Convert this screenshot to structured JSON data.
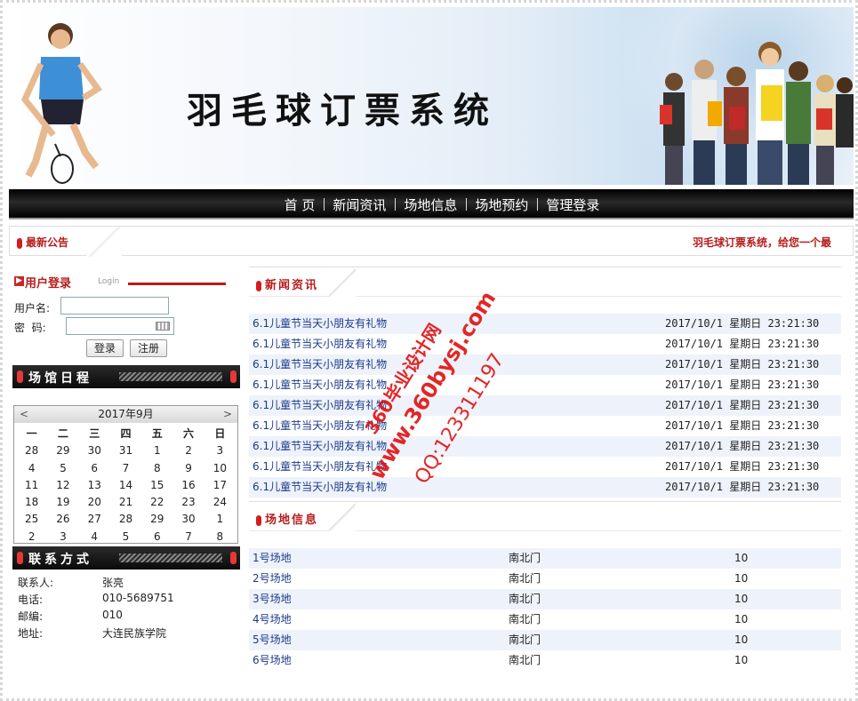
{
  "header": {
    "title": "羽毛球订票系统"
  },
  "nav": [
    "首 页",
    "新闻资讯",
    "场地信息",
    "场地预约",
    "管理登录"
  ],
  "notice": {
    "label": "最新公告",
    "marquee": "羽毛球订票系统，给您一个最"
  },
  "login": {
    "title": "用户登录",
    "title_en": "Login",
    "username_label": "用户名:",
    "password_label": "密  码:",
    "login_button": "登录",
    "register_button": "注册"
  },
  "schedule": {
    "title": "场馆日程",
    "month_label": "2017年9月",
    "prev": "<",
    "next": ">",
    "weekdays": [
      "一",
      "二",
      "三",
      "四",
      "五",
      "六",
      "日"
    ],
    "days": [
      "28",
      "29",
      "30",
      "31",
      "1",
      "2",
      "3",
      "4",
      "5",
      "6",
      "7",
      "8",
      "9",
      "10",
      "11",
      "12",
      "13",
      "14",
      "15",
      "16",
      "17",
      "18",
      "19",
      "20",
      "21",
      "22",
      "23",
      "24",
      "25",
      "26",
      "27",
      "28",
      "29",
      "30",
      "1",
      "2",
      "3",
      "4",
      "5",
      "6",
      "7",
      "8"
    ]
  },
  "contact": {
    "title": "联系方式",
    "items": [
      {
        "k": "联系人:",
        "v": "张亮"
      },
      {
        "k": "电话:",
        "v": "010-5689751"
      },
      {
        "k": "邮编:",
        "v": "010"
      },
      {
        "k": "地址:",
        "v": "大连民族学院"
      }
    ]
  },
  "news": {
    "title": "新闻资讯",
    "items": [
      {
        "title": "6.1儿童节当天小朋友有礼物",
        "date": "2017/10/1 星期日 23:21:30"
      },
      {
        "title": "6.1儿童节当天小朋友有礼物",
        "date": "2017/10/1 星期日 23:21:30"
      },
      {
        "title": "6.1儿童节当天小朋友有礼物",
        "date": "2017/10/1 星期日 23:21:30"
      },
      {
        "title": "6.1儿童节当天小朋友有礼物",
        "date": "2017/10/1 星期日 23:21:30"
      },
      {
        "title": "6.1儿童节当天小朋友有礼物",
        "date": "2017/10/1 星期日 23:21:30"
      },
      {
        "title": "6.1儿童节当天小朋友有礼物",
        "date": "2017/10/1 星期日 23:21:30"
      },
      {
        "title": "6.1儿童节当天小朋友有礼物",
        "date": "2017/10/1 星期日 23:21:30"
      },
      {
        "title": "6.1儿童节当天小朋友有礼物",
        "date": "2017/10/1 星期日 23:21:30"
      },
      {
        "title": "6.1儿童节当天小朋友有礼物",
        "date": "2017/10/1 星期日 23:21:30"
      }
    ]
  },
  "venues": {
    "title": "场地信息",
    "items": [
      {
        "name": "1号场地",
        "location": "南北门",
        "price": "10"
      },
      {
        "name": "2号场地",
        "location": "南北门",
        "price": "10"
      },
      {
        "name": "3号场地",
        "location": "南北门",
        "price": "10"
      },
      {
        "name": "4号场地",
        "location": "南北门",
        "price": "10"
      },
      {
        "name": "5号场地",
        "location": "南北门",
        "price": "10"
      },
      {
        "name": "6号场地",
        "location": "南北门",
        "price": "10"
      }
    ]
  },
  "watermark": {
    "line1": "360毕业设计网",
    "line2": "www.360bysj.com",
    "line3": "QQ:123311197"
  },
  "colors": {
    "accent_red": "#b71c1c",
    "link_blue": "#1a3a8a",
    "row_stripe": "#eef2fa"
  }
}
